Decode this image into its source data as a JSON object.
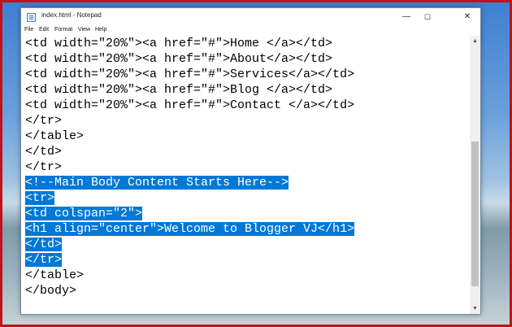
{
  "window": {
    "title": "index.html - Notepad",
    "controls": {
      "minimize": "—",
      "maximize": "☐",
      "close": "✕"
    }
  },
  "menu": {
    "file": "File",
    "edit": "Edit",
    "format": "Format",
    "view": "View",
    "help": "Help"
  },
  "editor": {
    "lines": [
      {
        "text": "<td width=\"20%\"><a href=\"#\">Home </a></td>",
        "selected": false
      },
      {
        "text": "<td width=\"20%\"><a href=\"#\">About</a></td>",
        "selected": false
      },
      {
        "text": "<td width=\"20%\"><a href=\"#\">Services</a></td>",
        "selected": false
      },
      {
        "text": "<td width=\"20%\"><a href=\"#\">Blog </a></td>",
        "selected": false
      },
      {
        "text": "<td width=\"20%\"><a href=\"#\">Contact </a></td>",
        "selected": false
      },
      {
        "text": "</tr>",
        "selected": false
      },
      {
        "text": "</table>",
        "selected": false
      },
      {
        "text": "</td>",
        "selected": false
      },
      {
        "text": "</tr>",
        "selected": false
      },
      {
        "text": "<!--Main Body Content Starts Here-->",
        "selected": true
      },
      {
        "text": "<tr>",
        "selected": true
      },
      {
        "text": "<td colspan=\"2\">",
        "selected": true
      },
      {
        "text": "<h1 align=\"center\">Welcome to Blogger VJ</h1>",
        "selected": true
      },
      {
        "text": "</td>",
        "selected": true
      },
      {
        "text": "</tr>",
        "selected": true
      },
      {
        "text": "</table>",
        "selected": false
      },
      {
        "text": "</body>",
        "selected": false
      }
    ]
  },
  "colors": {
    "selection": "#0078d7",
    "frame": "#c1121b"
  }
}
